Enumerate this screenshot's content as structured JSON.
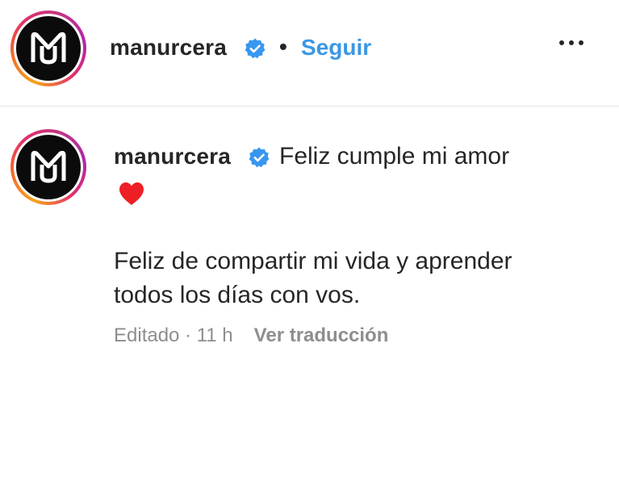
{
  "header": {
    "username": "manurcera",
    "separator": "•",
    "follow_label": "Seguir"
  },
  "comment": {
    "username": "manurcera",
    "first_line": "Feliz cumple mi amor",
    "emoji": "heart-icon",
    "body_lines": [
      "Feliz de compartir mi vida y aprender",
      "todos los días con vos."
    ],
    "timestamp": "Editado · 11 h",
    "translate_label": "Ver traducción"
  },
  "colors": {
    "accent": "#3b97e3",
    "verified": "#3897f0",
    "heart": "#ed1f24",
    "muted": "#8e8e8e"
  }
}
